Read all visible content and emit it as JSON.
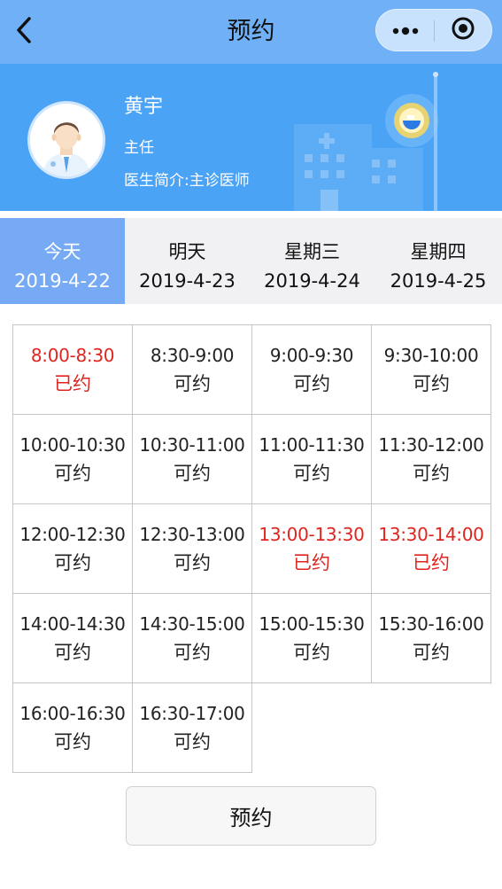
{
  "nav": {
    "title": "预约",
    "icons": {
      "back": "chevron-left-icon",
      "more": "more-dots-icon",
      "close": "target-close-icon"
    }
  },
  "doctor": {
    "name": "黄宇",
    "title": "主任",
    "intro": "医生简介:主诊医师",
    "avatar_icon": "doctor-avatar-icon"
  },
  "tabs": [
    {
      "day": "今天",
      "date": "2019-4-22",
      "active": true
    },
    {
      "day": "明天",
      "date": "2019-4-23",
      "active": false
    },
    {
      "day": "星期三",
      "date": "2019-4-24",
      "active": false
    },
    {
      "day": "星期四",
      "date": "2019-4-25",
      "active": false
    }
  ],
  "slots": [
    {
      "time": "8:00-8:30",
      "status": "已约",
      "booked": true
    },
    {
      "time": "8:30-9:00",
      "status": "可约",
      "booked": false
    },
    {
      "time": "9:00-9:30",
      "status": "可约",
      "booked": false
    },
    {
      "time": "9:30-10:00",
      "status": "可约",
      "booked": false
    },
    {
      "time": "10:00-10:30",
      "status": "可约",
      "booked": false
    },
    {
      "time": "10:30-11:00",
      "status": "可约",
      "booked": false
    },
    {
      "time": "11:00-11:30",
      "status": "可约",
      "booked": false
    },
    {
      "time": "11:30-12:00",
      "status": "可约",
      "booked": false
    },
    {
      "time": "12:00-12:30",
      "status": "可约",
      "booked": false
    },
    {
      "time": "12:30-13:00",
      "status": "可约",
      "booked": false
    },
    {
      "time": "13:00-13:30",
      "status": "已约",
      "booked": true
    },
    {
      "time": "13:30-14:00",
      "status": "已约",
      "booked": true
    },
    {
      "time": "14:00-14:30",
      "status": "可约",
      "booked": false
    },
    {
      "time": "14:30-15:00",
      "status": "可约",
      "booked": false
    },
    {
      "time": "15:00-15:30",
      "status": "可约",
      "booked": false
    },
    {
      "time": "15:30-16:00",
      "status": "可约",
      "booked": false
    },
    {
      "time": "16:00-16:30",
      "status": "可约",
      "booked": false
    },
    {
      "time": "16:30-17:00",
      "status": "可约",
      "booked": false
    }
  ],
  "submit_label": "预约",
  "colors": {
    "navbar": "#6fb0f7",
    "banner": "#4ba3f5",
    "active_tab": "#77aaf5",
    "booked_text": "#e0251f"
  }
}
